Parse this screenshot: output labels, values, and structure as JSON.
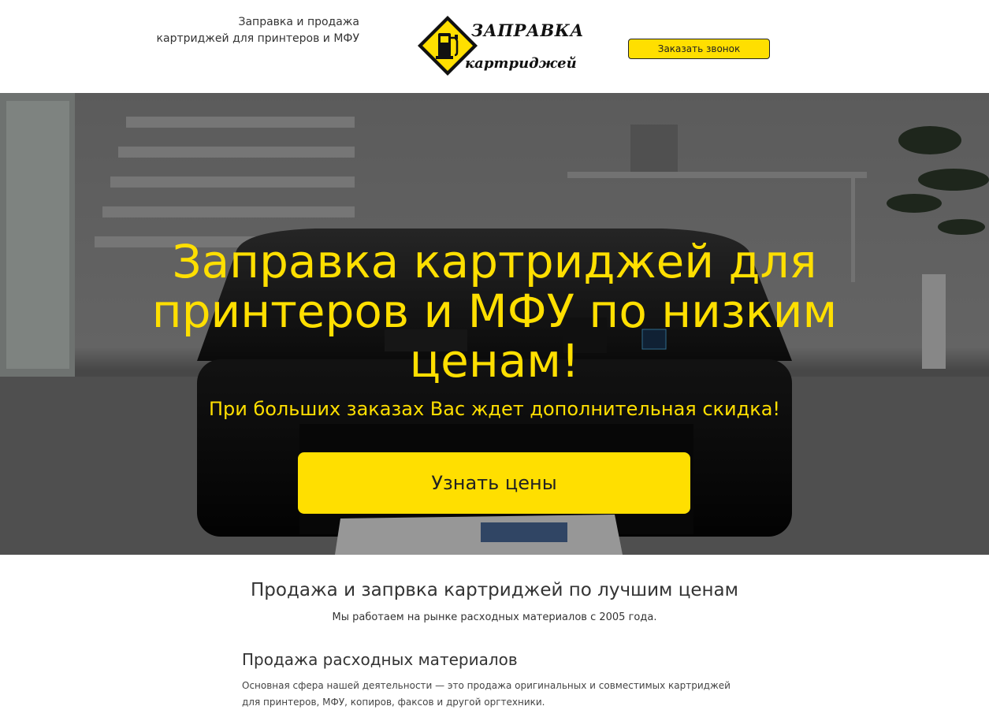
{
  "header": {
    "tagline_line1": "Заправка и продажа",
    "tagline_line2": "картриджей для принтеров и МФУ",
    "logo": {
      "line1": "ЗАПРАВКА",
      "line2": "картриджей",
      "icon": "fuel-pump-diamond-icon",
      "colors": {
        "diamond": "#ffdf00",
        "outline": "#111111"
      }
    },
    "call_button_label": "Заказать звонок"
  },
  "hero": {
    "title": "Заправка картриджей для принтеров и МФУ по низким ценам!",
    "subtitle": "При больших заказах Вас ждет дополнительная скидка!",
    "cta_label": "Узнать цены",
    "background": "printer-photo"
  },
  "content": {
    "section_title": "Продажа и запрвка картриджей по лучшим ценам",
    "section_subtitle": "Мы работаем на рынке расходных материалов с 2005 года.",
    "block_title": "Продажа расходных материалов",
    "block_text": "Основная сфера нашей деятельности — это продажа оригинальных и совместимых картриджей для принтеров, МФУ, копиров, факсов и другой оргтехники."
  },
  "colors": {
    "accent": "#ffdf00",
    "text": "#333333"
  }
}
